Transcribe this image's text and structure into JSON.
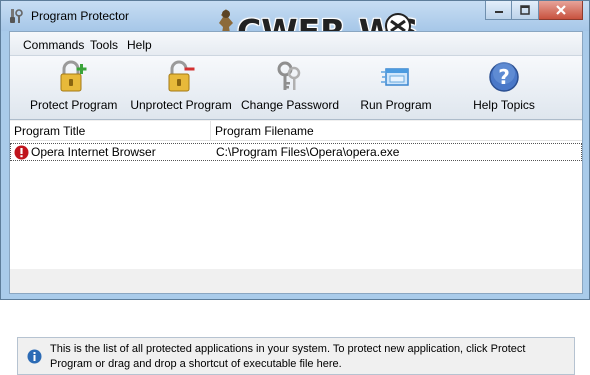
{
  "window": {
    "title": "Program Protector",
    "watermark": "CWER.WS",
    "controls": {
      "minimize": "–",
      "maximize": "□",
      "close": "✕"
    }
  },
  "menu": [
    "Commands",
    "Tools",
    "Help"
  ],
  "toolbar": [
    {
      "label": "Protect Program",
      "icon": "lock-plus-icon"
    },
    {
      "label": "Unprotect Program",
      "icon": "lock-minus-icon"
    },
    {
      "label": "Change Password",
      "icon": "keys-icon"
    },
    {
      "label": "Run Program",
      "icon": "run-window-icon"
    },
    {
      "label": "Help Topics",
      "icon": "help-question-icon"
    }
  ],
  "list": {
    "columns": [
      "Program Title",
      "Program Filename"
    ],
    "rows": [
      {
        "title": "Opera Internet Browser",
        "filename": "C:\\Program Files\\Opera\\opera.exe",
        "status_icon": "protected-alert-icon"
      }
    ]
  },
  "info": {
    "text": "This is the list of all protected applications in your system. To protect new application, click Protect Program or drag and drop a shortcut of executable file here.",
    "icon": "info-icon"
  },
  "colors": {
    "frame": "#a9cbea",
    "status_red": "#c0151d",
    "info_blue": "#2c6bb5"
  }
}
